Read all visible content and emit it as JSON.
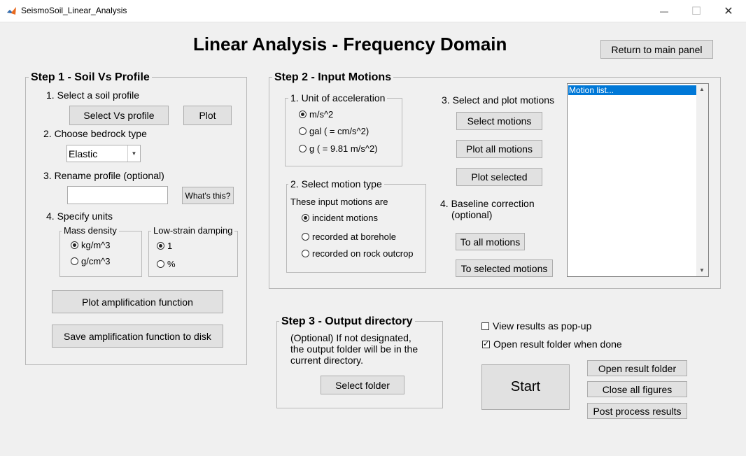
{
  "window": {
    "title": "SeismoSoil_Linear_Analysis",
    "minimize": "—",
    "maximize": "☐",
    "close": "✕"
  },
  "header": {
    "title": "Linear Analysis - Frequency Domain",
    "return_button": "Return to main panel"
  },
  "step1": {
    "title": "Step 1 - Soil Vs Profile",
    "select_label": "1. Select a soil profile",
    "select_button": "Select Vs profile",
    "plot_button": "Plot",
    "bedrock_label": "2. Choose bedrock type",
    "bedrock_value": "Elastic",
    "rename_label": "3. Rename profile (optional)",
    "rename_value": "",
    "whats_this": "What's this?",
    "units_label": "4. Specify units",
    "mass_density": {
      "title": "Mass density",
      "options": [
        "kg/m^3",
        "g/cm^3"
      ],
      "selected": "kg/m^3"
    },
    "damping": {
      "title": "Low-strain damping",
      "options": [
        "1",
        "%"
      ],
      "selected": "1"
    },
    "plot_amp_button": "Plot amplification function",
    "save_amp_button": "Save amplification function to disk"
  },
  "step2": {
    "title": "Step 2 - Input Motions",
    "unit_group": {
      "title": "1. Unit of acceleration",
      "options": [
        "m/s^2",
        "gal ( = cm/s^2)",
        "g ( = 9.81 m/s^2)"
      ],
      "selected": "m/s^2"
    },
    "motion_type": {
      "title": "2. Select motion type",
      "subtitle": "These input motions are",
      "options": [
        "incident motions",
        "recorded at borehole",
        "recorded on rock outcrop"
      ],
      "selected": "incident motions"
    },
    "select_plot_label": "3. Select and plot motions",
    "select_motions_button": "Select motions",
    "plot_all_button": "Plot all motions",
    "plot_selected_button": "Plot selected",
    "baseline_label_1": "4. Baseline correction",
    "baseline_label_2": "(optional)",
    "to_all_button": "To all motions",
    "to_selected_button": "To selected motions",
    "motion_list": [
      "Motion list..."
    ]
  },
  "step3": {
    "title": "Step 3 - Output directory",
    "desc_1": "(Optional) If not designated,",
    "desc_2": "the output folder will be in the",
    "desc_3": "current directory.",
    "select_folder_button": "Select folder"
  },
  "options": {
    "view_popup": {
      "label": "View results as pop-up",
      "checked": false
    },
    "open_folder_done": {
      "label": "Open result folder when done",
      "checked": true
    }
  },
  "actions": {
    "start": "Start",
    "open_result_folder": "Open result folder",
    "close_all_figures": "Close all figures",
    "post_process": "Post process results"
  },
  "icons": {
    "checkmark": "✓",
    "scroll_up": "▲",
    "scroll_down": "▼",
    "dropdown": "▼"
  }
}
